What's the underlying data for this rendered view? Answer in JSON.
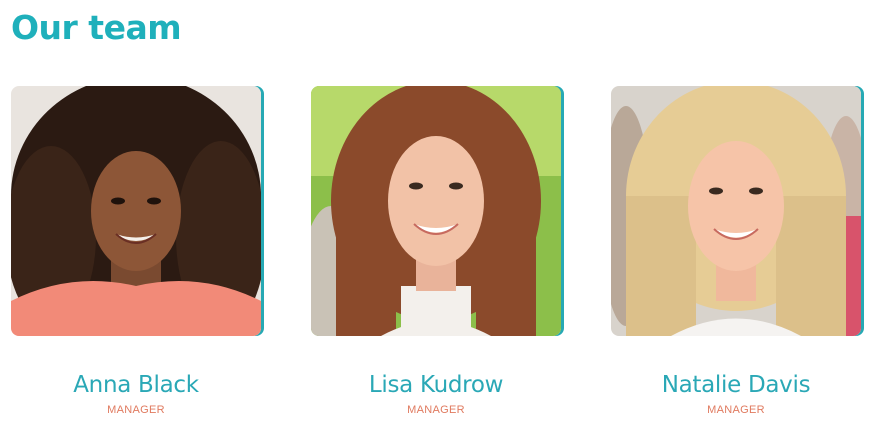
{
  "section": {
    "title": "Our team"
  },
  "members": [
    {
      "name": "Anna Black",
      "role": "MANAGER"
    },
    {
      "name": "Lisa Kudrow",
      "role": "MANAGER"
    },
    {
      "name": "Natalie Davis",
      "role": "MANAGER"
    }
  ],
  "colors": {
    "title": "#1fb0bb",
    "name": "#2aa8b6",
    "role": "#e07a5f",
    "card_accent": "#27a9b4"
  }
}
